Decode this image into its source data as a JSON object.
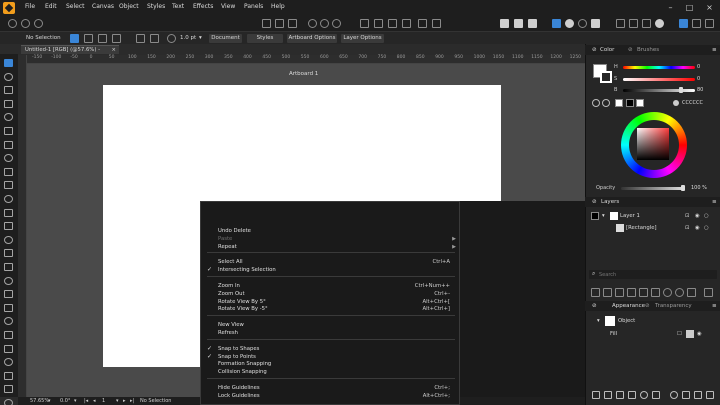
{
  "menu": [
    "File",
    "Edit",
    "Select",
    "Canvas",
    "Object",
    "Styles",
    "Text",
    "Effects",
    "View",
    "Panels",
    "Help"
  ],
  "context_bar": {
    "selection": "No Selection",
    "stroke_width": "1.0 pt",
    "buttons": [
      "Document",
      "Styles",
      "Artboard Options",
      "Layer Options"
    ]
  },
  "document_tab": {
    "title": "Untitled-1 [RGB] (@57.6%) - [Modified]",
    "close": "×"
  },
  "ruler_ticks": [
    "-150",
    "-100",
    "-50",
    "0",
    "50",
    "100",
    "150",
    "200",
    "250",
    "300",
    "350",
    "400",
    "450",
    "500",
    "550",
    "600",
    "650",
    "700",
    "750",
    "800",
    "850",
    "900",
    "950",
    "1000",
    "1050",
    "1100",
    "1150",
    "1200",
    "1250"
  ],
  "artboard": {
    "label": "Artboard 1"
  },
  "context_menu": [
    {
      "label": "Undo Delete",
      "shortcut": "",
      "checked": false,
      "submenu": false,
      "disabled": false,
      "sep_before": false
    },
    {
      "label": "Paste",
      "shortcut": "",
      "checked": false,
      "submenu": true,
      "disabled": true,
      "sep_before": false
    },
    {
      "label": "Repeat",
      "shortcut": "",
      "checked": false,
      "submenu": true,
      "disabled": false,
      "sep_before": false
    },
    {
      "label": "Select All",
      "shortcut": "Ctrl+A",
      "checked": false,
      "submenu": false,
      "disabled": false,
      "sep_before": true
    },
    {
      "label": "Intersecting Selection",
      "shortcut": "",
      "checked": true,
      "submenu": false,
      "disabled": false,
      "sep_before": false
    },
    {
      "label": "Zoom In",
      "shortcut": "Ctrl+Num++",
      "checked": false,
      "submenu": false,
      "disabled": false,
      "sep_before": true
    },
    {
      "label": "Zoom Out",
      "shortcut": "Ctrl+-",
      "checked": false,
      "submenu": false,
      "disabled": false,
      "sep_before": false
    },
    {
      "label": "Rotate View By 5°",
      "shortcut": "Alt+Ctrl+[",
      "checked": false,
      "submenu": false,
      "disabled": false,
      "sep_before": false
    },
    {
      "label": "Rotate View By -5°",
      "shortcut": "Alt+Ctrl+]",
      "checked": false,
      "submenu": false,
      "disabled": false,
      "sep_before": false
    },
    {
      "label": "New View",
      "shortcut": "",
      "checked": false,
      "submenu": false,
      "disabled": false,
      "sep_before": true
    },
    {
      "label": "Refresh",
      "shortcut": "",
      "checked": false,
      "submenu": false,
      "disabled": false,
      "sep_before": false
    },
    {
      "label": "Snap to Shapes",
      "shortcut": "",
      "checked": true,
      "submenu": false,
      "disabled": false,
      "sep_before": true
    },
    {
      "label": "Snap to Points",
      "shortcut": "",
      "checked": true,
      "submenu": false,
      "disabled": false,
      "sep_before": false
    },
    {
      "label": "Formation Snapping",
      "shortcut": "",
      "checked": false,
      "submenu": false,
      "disabled": false,
      "sep_before": false
    },
    {
      "label": "Collision Snapping",
      "shortcut": "",
      "checked": false,
      "submenu": false,
      "disabled": false,
      "sep_before": false
    },
    {
      "label": "Hide Guidelines",
      "shortcut": "Ctrl+;",
      "checked": false,
      "submenu": false,
      "disabled": false,
      "sep_before": true
    },
    {
      "label": "Lock Guidelines",
      "shortcut": "Alt+Ctrl+;",
      "checked": false,
      "submenu": false,
      "disabled": false,
      "sep_before": false
    }
  ],
  "status_bar": {
    "zoom": "57.65%",
    "angle": "0.0°",
    "page": "1",
    "selection": "No Selection"
  },
  "color_panel": {
    "tabs": [
      "Color",
      "Brushes"
    ],
    "sliders": [
      {
        "label": "H",
        "value": "0"
      },
      {
        "label": "S",
        "value": "0"
      },
      {
        "label": "B",
        "value": "80"
      }
    ],
    "hex": "CCCCCC",
    "opacity_label": "Opacity",
    "opacity_value": "100 %",
    "opacity_fraction": 1.0,
    "brightness_fraction": 0.8
  },
  "layers_panel": {
    "tab": "Layers",
    "layers": [
      {
        "name": "Layer 1"
      },
      {
        "name": "[Rectangle]"
      }
    ],
    "search_placeholder": "Search"
  },
  "appearance_panel": {
    "tabs": [
      "Appearance",
      "Transparency"
    ],
    "object_label": "Object",
    "fill_label": "Fill"
  },
  "colors": {
    "accent": "#f29d1c",
    "canvas": "#4a4a4a",
    "menu_bg": "#1a1a1a",
    "selected_tool": "#3a86d8"
  }
}
